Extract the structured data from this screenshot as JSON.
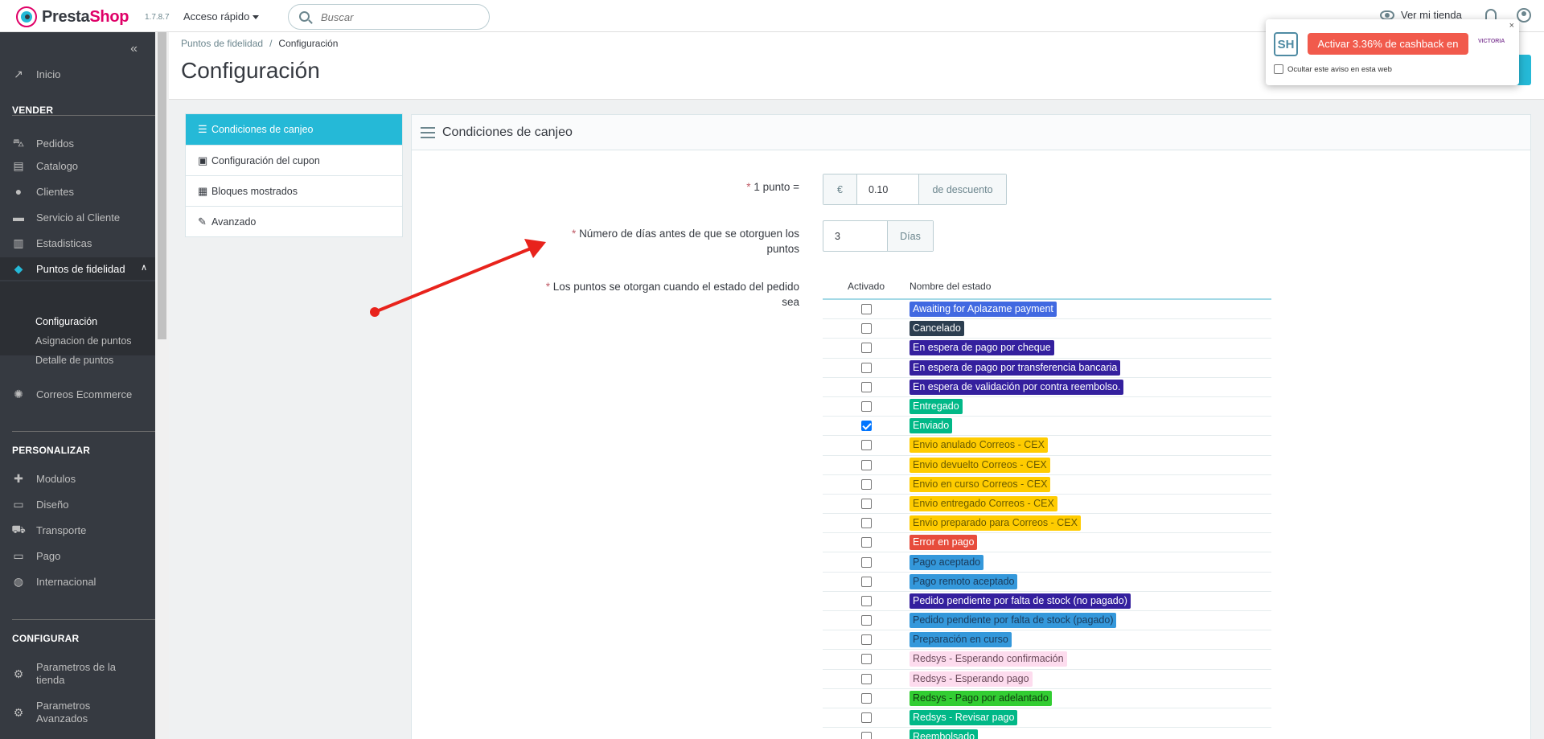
{
  "header": {
    "brand_presta": "Presta",
    "brand_shop": "Shop",
    "version": "1.7.8.7",
    "quick_access": "Acceso rápido",
    "search_placeholder": "Buscar",
    "view_store": "Ver mi tienda"
  },
  "sidebar": {
    "home": "Inicio",
    "sections": {
      "sell": "VENDER",
      "customize": "PERSONALIZAR",
      "configure": "CONFIGURAR"
    },
    "sell_items": [
      "Pedidos",
      "Catalogo",
      "Clientes",
      "Servicio al Cliente",
      "Estadisticas",
      "Puntos de fidelidad"
    ],
    "loyalty_sub": [
      "Configuración",
      "Asignacion de puntos",
      "Detalle de puntos"
    ],
    "correos": "Correos Ecommerce",
    "customize_items": [
      "Modulos",
      "Diseño",
      "Transporte",
      "Pago",
      "Internacional"
    ],
    "configure_items": [
      {
        "line1": "Parametros de la",
        "line2": "tienda"
      },
      {
        "line1": "Parametros",
        "line2": "Avanzados"
      }
    ]
  },
  "page": {
    "breadcrumb_parent": "Puntos de fidelidad",
    "breadcrumb_current": "Configuración",
    "title": "Configuración"
  },
  "config_menu": [
    "Condiciones de canjeo",
    "Configuración del cupon",
    "Bloques mostrados",
    "Avanzado"
  ],
  "panel": {
    "title": "Condiciones de canjeo",
    "point_label": "1 punto =",
    "currency": "€",
    "point_value": "0.10",
    "discount_suffix": "de descuento",
    "days_label_1": "Número de días antes de que se otorguen los",
    "days_label_2": "puntos",
    "days_value": "3",
    "days_suffix": "Días",
    "states_label_1": "Los puntos se otorgan cuando el estado del pedido",
    "states_label_2": "sea",
    "col_enabled": "Activado",
    "col_state": "Nombre del estado",
    "states": [
      {
        "name": "Awaiting for Aplazame payment",
        "bg": "#4169e1",
        "fg": "#ffffff",
        "checked": false
      },
      {
        "name": "Cancelado",
        "bg": "#2c3e50",
        "fg": "#ffffff",
        "checked": false
      },
      {
        "name": "En espera de pago por cheque",
        "bg": "#34209e",
        "fg": "#ffffff",
        "checked": false
      },
      {
        "name": "En espera de pago por transferencia bancaria",
        "bg": "#34209e",
        "fg": "#ffffff",
        "checked": false
      },
      {
        "name": "En espera de validación por contra reembolso.",
        "bg": "#34209e",
        "fg": "#ffffff",
        "checked": false
      },
      {
        "name": "Entregado",
        "bg": "#01b887",
        "fg": "#ffffff",
        "checked": false
      },
      {
        "name": "Enviado",
        "bg": "#01b887",
        "fg": "#ffffff",
        "checked": true
      },
      {
        "name": "Envio anulado Correos - CEX",
        "bg": "#ffcc00",
        "fg": "#6a5a00",
        "checked": false
      },
      {
        "name": "Envio devuelto Correos - CEX",
        "bg": "#ffcc00",
        "fg": "#6a5a00",
        "checked": false
      },
      {
        "name": "Envio en curso Correos - CEX",
        "bg": "#ffcc00",
        "fg": "#6a5a00",
        "checked": false
      },
      {
        "name": "Envio entregado Correos - CEX",
        "bg": "#ffcc00",
        "fg": "#6a5a00",
        "checked": false
      },
      {
        "name": "Envio preparado para Correos - CEX",
        "bg": "#ffcc00",
        "fg": "#6a5a00",
        "checked": false
      },
      {
        "name": "Error en pago",
        "bg": "#e74c3c",
        "fg": "#ffffff",
        "checked": false
      },
      {
        "name": "Pago aceptado",
        "bg": "#3498db",
        "fg": "#1a3a5a",
        "checked": false
      },
      {
        "name": "Pago remoto aceptado",
        "bg": "#3498db",
        "fg": "#1a3a5a",
        "checked": false
      },
      {
        "name": "Pedido pendiente por falta de stock (no pagado)",
        "bg": "#34209e",
        "fg": "#ffffff",
        "checked": false
      },
      {
        "name": "Pedido pendiente por falta de stock (pagado)",
        "bg": "#3498db",
        "fg": "#1a3a5a",
        "checked": false
      },
      {
        "name": "Preparación en curso",
        "bg": "#3498db",
        "fg": "#1a3a5a",
        "checked": false
      },
      {
        "name": "Redsys - Esperando confirmación",
        "bg": "#fddcee",
        "fg": "#6a4a5a",
        "checked": false
      },
      {
        "name": "Redsys - Esperando pago",
        "bg": "#fddcee",
        "fg": "#6a4a5a",
        "checked": false
      },
      {
        "name": "Redsys - Pago por adelantado",
        "bg": "#32cd32",
        "fg": "#0f3a0f",
        "checked": false
      },
      {
        "name": "Redsys - Revisar pago",
        "bg": "#01b887",
        "fg": "#ffffff",
        "checked": false
      },
      {
        "name": "Reembolsado",
        "bg": "#01b887",
        "fg": "#ffffff",
        "checked": false
      }
    ]
  },
  "popup": {
    "sh_logo": "SH",
    "cashback_button": "Activar 3.36% de cashback en",
    "brand": "VICTORIA",
    "hide_label": "Ocultar este aviso en esta web",
    "close": "×"
  }
}
